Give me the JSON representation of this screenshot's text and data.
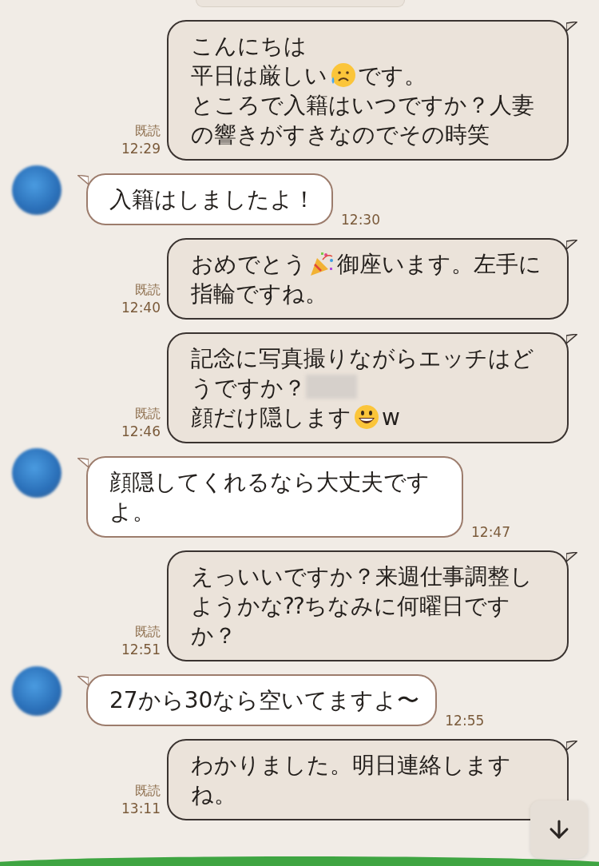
{
  "messages": [
    {
      "kind": "sent",
      "read_label": "既読",
      "time": "12:29",
      "parts": [
        {
          "kind": "text",
          "text": "こんにちは"
        },
        {
          "kind": "break"
        },
        {
          "kind": "text",
          "text": "平日は厳しい"
        },
        {
          "kind": "sad-emoji"
        },
        {
          "kind": "text",
          "text": "です。"
        },
        {
          "kind": "break"
        },
        {
          "kind": "text",
          "text": "ところで入籍はいつですか？人妻の響きがすきなのでその時笑"
        }
      ]
    },
    {
      "kind": "received",
      "time": "12:30",
      "parts": [
        {
          "kind": "text",
          "text": "入籍はしましたよ！"
        }
      ]
    },
    {
      "kind": "sent",
      "read_label": "既読",
      "time": "12:40",
      "parts": [
        {
          "kind": "text",
          "text": "おめでとう"
        },
        {
          "kind": "party-emoji"
        },
        {
          "kind": "text",
          "text": "御座います。左手に指輪ですね。"
        }
      ]
    },
    {
      "kind": "sent",
      "read_label": "既読",
      "time": "12:46",
      "parts": [
        {
          "kind": "text",
          "text": "記念に写真撮りながらエッチはどうですか？"
        },
        {
          "kind": "blurred"
        },
        {
          "kind": "break"
        },
        {
          "kind": "text",
          "text": "顔だけ隠します"
        },
        {
          "kind": "smile-emoji"
        },
        {
          "kind": "text",
          "text": "w"
        }
      ]
    },
    {
      "kind": "received",
      "time": "12:47",
      "parts": [
        {
          "kind": "text",
          "text": "顔隠してくれるなら大丈夫ですよ。"
        }
      ]
    },
    {
      "kind": "sent",
      "read_label": "既読",
      "time": "12:51",
      "parts": [
        {
          "kind": "text",
          "text": "えっいいですか？来週仕事調整しようかな⁇ちなみに何曜日ですか？"
        }
      ]
    },
    {
      "kind": "received",
      "time": "12:55",
      "parts": [
        {
          "kind": "text",
          "text": "27から30なら空いてますよ〜"
        }
      ]
    },
    {
      "kind": "sent",
      "read_label": "既読",
      "time": "13:11",
      "parts": [
        {
          "kind": "text",
          "text": "わかりました。明日連絡しますね。"
        }
      ]
    }
  ]
}
